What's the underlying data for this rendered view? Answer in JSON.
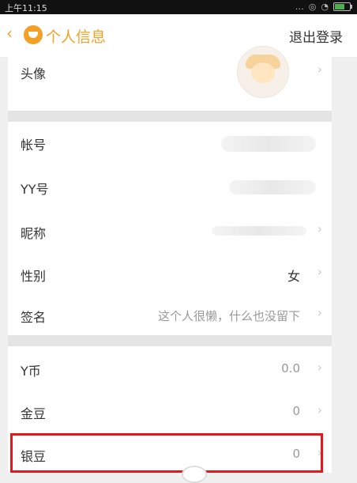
{
  "status_bar": {
    "time": "上午11:15",
    "icons": [
      "more-icon",
      "signal-icon",
      "wifi-icon",
      "battery-icon"
    ]
  },
  "header": {
    "title": "个人信息",
    "logout_label": "退出登录"
  },
  "section1": [
    {
      "label": "头像"
    }
  ],
  "section2": [
    {
      "label": "帐号",
      "value": ""
    },
    {
      "label": "YY号",
      "value": ""
    },
    {
      "label": "昵称",
      "value": ""
    },
    {
      "label": "性别",
      "value": "女"
    },
    {
      "label": "签名",
      "value": "这个人很懒，什么也没留下"
    }
  ],
  "section3": [
    {
      "label": "Y币",
      "value": "0.0"
    },
    {
      "label": "金豆",
      "value": "0"
    },
    {
      "label": "银豆",
      "value": "0"
    }
  ],
  "colors": {
    "accent": "#f2a126",
    "highlight": "#e1181c",
    "background": "#f0f0f0"
  }
}
